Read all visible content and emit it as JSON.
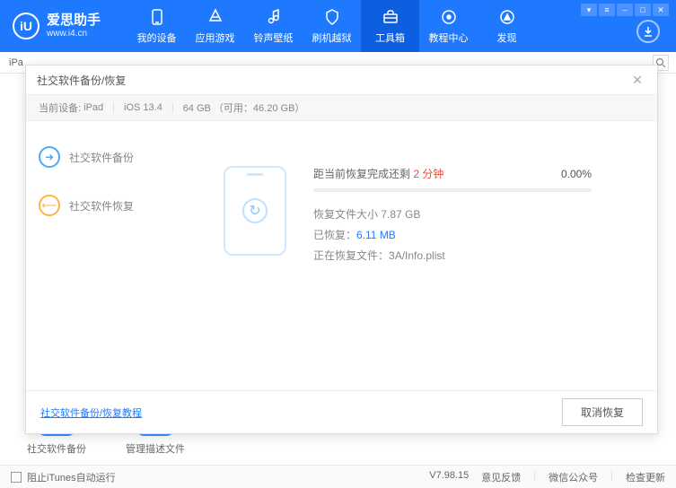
{
  "logo": {
    "title": "爱思助手",
    "url": "www.i4.cn",
    "mark": "iU"
  },
  "nav": [
    {
      "icon": "phone",
      "label": "我的设备"
    },
    {
      "icon": "apps",
      "label": "应用游戏"
    },
    {
      "icon": "ring",
      "label": "铃声壁纸"
    },
    {
      "icon": "shield",
      "label": "刷机越狱"
    },
    {
      "icon": "toolbox",
      "label": "工具箱",
      "active": true
    },
    {
      "icon": "book",
      "label": "教程中心"
    },
    {
      "icon": "compass",
      "label": "发现"
    }
  ],
  "tab": {
    "device": "iPa"
  },
  "modal": {
    "title": "社交软件备份/恢复",
    "deviceLabel": "当前设备:",
    "deviceName": "iPad",
    "ios": "iOS 13.4",
    "storage": "64 GB （可用：46.20 GB）",
    "side": [
      {
        "label": "社交软件备份"
      },
      {
        "label": "社交软件恢复"
      }
    ],
    "progress": {
      "timePrefix": "距当前恢复完成还剩",
      "timeValue": "2 分钟",
      "percent": "0.00%",
      "sizeLabel": "恢复文件大小",
      "sizeValue": "7.87 GB",
      "doneLabel": "已恢复：",
      "doneValue": "6.11 MB",
      "fileLabel": "正在恢复文件：",
      "fileValue": "3A/Info.plist"
    },
    "tutorialLink": "社交软件备份/恢复教程",
    "cancel": "取消恢复"
  },
  "bgIcons": [
    {
      "label": "社交软件备份"
    },
    {
      "label": "管理描述文件"
    }
  ],
  "footer": {
    "checkbox": "阻止iTunes自动运行",
    "version": "V7.98.15",
    "links": [
      "意见反馈",
      "微信公众号",
      "检查更新"
    ]
  }
}
